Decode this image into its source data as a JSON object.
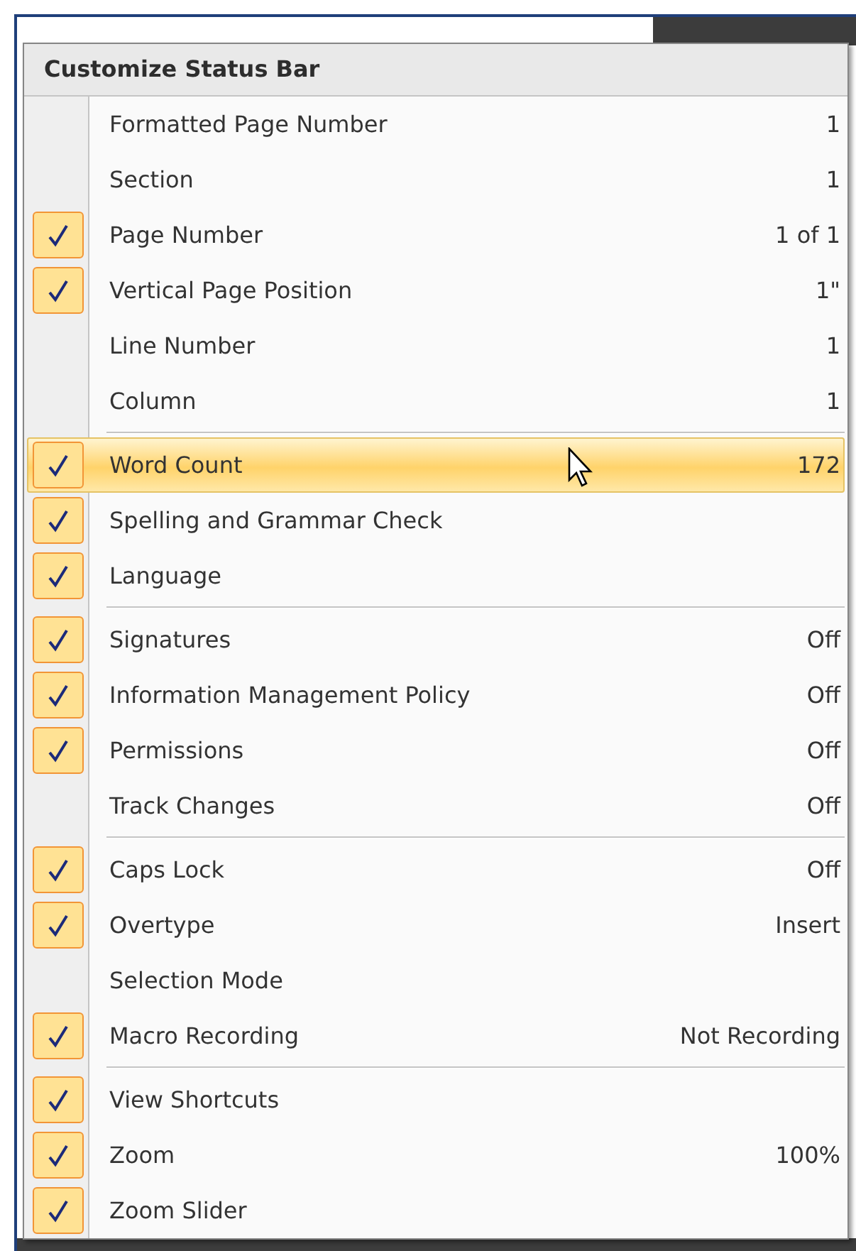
{
  "menu": {
    "title": "Customize Status Bar",
    "groups": [
      {
        "items": [
          {
            "label": "Formatted Page Number",
            "value": "1",
            "checked": false,
            "selected": false
          },
          {
            "label": "Section",
            "value": "1",
            "checked": false,
            "selected": false
          },
          {
            "label": "Page Number",
            "value": "1 of 1",
            "checked": true,
            "selected": false
          },
          {
            "label": "Vertical Page Position",
            "value": "1\"",
            "checked": true,
            "selected": false
          },
          {
            "label": "Line Number",
            "value": "1",
            "checked": false,
            "selected": false
          },
          {
            "label": "Column",
            "value": "1",
            "checked": false,
            "selected": false
          }
        ]
      },
      {
        "items": [
          {
            "label": "Word Count",
            "value": "172",
            "checked": true,
            "selected": true
          },
          {
            "label": "Spelling and Grammar Check",
            "checked": true,
            "selected": false
          },
          {
            "label": "Language",
            "checked": true,
            "selected": false
          }
        ]
      },
      {
        "items": [
          {
            "label": "Signatures",
            "value": "Off",
            "checked": true,
            "selected": false
          },
          {
            "label": "Information Management Policy",
            "value": "Off",
            "checked": true,
            "selected": false
          },
          {
            "label": "Permissions",
            "value": "Off",
            "checked": true,
            "selected": false
          },
          {
            "label": "Track Changes",
            "value": "Off",
            "checked": false,
            "selected": false
          }
        ]
      },
      {
        "items": [
          {
            "label": "Caps Lock",
            "value": "Off",
            "checked": true,
            "selected": false
          },
          {
            "label": "Overtype",
            "value": "Insert",
            "checked": true,
            "selected": false
          },
          {
            "label": "Selection Mode",
            "checked": false,
            "selected": false
          },
          {
            "label": "Macro Recording",
            "value": "Not Recording",
            "checked": true,
            "selected": false
          }
        ]
      },
      {
        "items": [
          {
            "label": "View Shortcuts",
            "checked": true,
            "selected": false
          },
          {
            "label": "Zoom",
            "value": "100%",
            "checked": true,
            "selected": false
          },
          {
            "label": "Zoom Slider",
            "checked": true,
            "selected": false
          }
        ]
      }
    ]
  }
}
